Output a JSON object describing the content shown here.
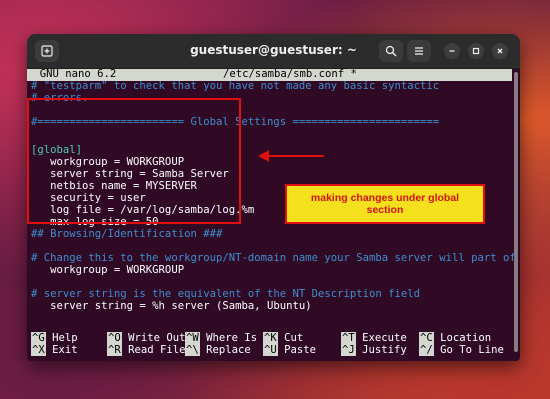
{
  "window": {
    "title": "guestuser@guestuser: ~"
  },
  "nano": {
    "header_app": "  GNU nano 6.2",
    "header_file": "/etc/samba/smb.conf *"
  },
  "lines": [
    {
      "text": "# \"testparm\" to check that you have not made any basic syntactic",
      "kind": "comment"
    },
    {
      "text": "# errors.",
      "kind": "comment"
    },
    {
      "text": "",
      "kind": "plain"
    },
    {
      "text": "#======================= Global Settings =======================",
      "kind": "comment"
    },
    {
      "text": "",
      "kind": "plain"
    },
    {
      "text": "[global]",
      "kind": "section"
    },
    {
      "text": "   workgroup = WORKGROUP",
      "kind": "plain"
    },
    {
      "text": "   server string = Samba Server",
      "kind": "plain"
    },
    {
      "text": "   netbios name = MYSERVER",
      "kind": "plain"
    },
    {
      "text": "   security = user",
      "kind": "plain"
    },
    {
      "text": "   log file = /var/log/samba/log.%m",
      "kind": "plain"
    },
    {
      "text": "   max log size = 50",
      "kind": "plain"
    },
    {
      "text": "## Browsing/Identification ###",
      "kind": "comment"
    },
    {
      "text": "",
      "kind": "plain"
    },
    {
      "text": "# Change this to the workgroup/NT-domain name your Samba server will part of",
      "kind": "comment"
    },
    {
      "text": "   workgroup = WORKGROUP",
      "kind": "plain"
    },
    {
      "text": "",
      "kind": "plain"
    },
    {
      "text": "# server string is the equivalent of the NT Description field",
      "kind": "comment"
    },
    {
      "text": "   server string = %h server (Samba, Ubuntu)",
      "kind": "plain"
    }
  ],
  "shortcuts": {
    "row1": [
      {
        "key": "^G",
        "label": "Help"
      },
      {
        "key": "^O",
        "label": "Write Out"
      },
      {
        "key": "^W",
        "label": "Where Is"
      },
      {
        "key": "^K",
        "label": "Cut"
      },
      {
        "key": "^T",
        "label": "Execute"
      },
      {
        "key": "^C",
        "label": "Location"
      }
    ],
    "row2": [
      {
        "key": "^X",
        "label": "Exit"
      },
      {
        "key": "^R",
        "label": "Read File"
      },
      {
        "key": "^\\",
        "label": "Replace"
      },
      {
        "key": "^U",
        "label": "Paste"
      },
      {
        "key": "^J",
        "label": "Justify"
      },
      {
        "key": "^/",
        "label": "Go To Line"
      }
    ]
  },
  "annotation": {
    "callout_text": "making changes under global section"
  },
  "colors": {
    "terminal_bg": "#300a24",
    "comment": "#3e8ed0",
    "section": "#4ec9b0",
    "annotation_red": "#e01010",
    "callout_bg": "#f4e01c"
  },
  "icons": {
    "new_tab": "new-tab-icon",
    "search": "search-icon",
    "menu": "hamburger-menu-icon",
    "minimize": "minimize-icon",
    "maximize": "maximize-icon",
    "close": "close-icon"
  }
}
